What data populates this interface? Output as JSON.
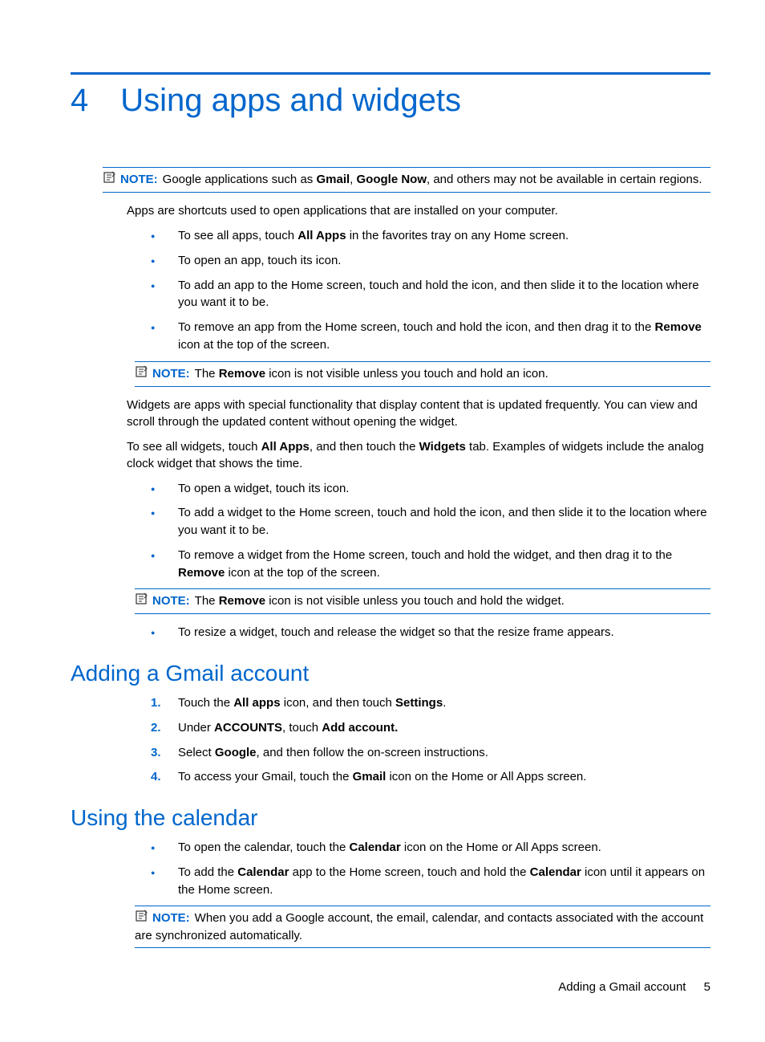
{
  "chapter": {
    "number": "4",
    "title": "Using apps and widgets"
  },
  "note_label": "NOTE:",
  "note1": {
    "pre": "Google applications such as ",
    "b1": "Gmail",
    "mid1": ", ",
    "b2": "Google Now",
    "post": ", and others may not be available in certain regions."
  },
  "p1": "Apps are shortcuts used to open applications that are installed on your computer.",
  "bullets1": {
    "i0": {
      "a": "To see all apps, touch ",
      "b": "All Apps",
      "c": " in the favorites tray on any Home screen."
    },
    "i1": {
      "a": "To open an app, touch its icon."
    },
    "i2": {
      "a": "To add an app to the Home screen, touch and hold the icon, and then slide it to the location where you want it to be."
    },
    "i3": {
      "a": "To remove an app from the Home screen, touch and hold the icon, and then drag it to the ",
      "b": "Remove",
      "c": " icon at the top of the screen."
    }
  },
  "note2": {
    "a": "The ",
    "b": "Remove",
    "c": " icon is not visible unless you touch and hold an icon."
  },
  "p2": "Widgets are apps with special functionality that display content that is updated frequently. You can view and scroll through the updated content without opening the widget.",
  "p3": {
    "a": "To see all widgets, touch ",
    "b1": "All Apps",
    "m": ", and then touch the ",
    "b2": "Widgets",
    "c": " tab. Examples of widgets include the analog clock widget that shows the time."
  },
  "bullets2": {
    "i0": {
      "a": "To open a widget, touch its icon."
    },
    "i1": {
      "a": "To add a widget to the Home screen, touch and hold the icon, and then slide it to the location where you want it to be."
    },
    "i2": {
      "a": "To remove a widget from the Home screen, touch and hold the widget, and then drag it to the ",
      "b": "Remove",
      "c": " icon at the top of the screen."
    }
  },
  "note3": {
    "a": "The ",
    "b": "Remove",
    "c": " icon is not visible unless you touch and hold the widget."
  },
  "bullets3": {
    "i0": {
      "a": "To resize a widget, touch and release the widget so that the resize frame appears."
    }
  },
  "section_gmail": "Adding a Gmail account",
  "steps1": {
    "s0": {
      "a": "Touch the ",
      "b1": "All apps",
      "m": " icon, and then touch ",
      "b2": "Settings",
      "c": "."
    },
    "s1": {
      "a": "Under ",
      "b1": "ACCOUNTS",
      "m": ", touch ",
      "b2": "Add account."
    },
    "s2": {
      "a": "Select ",
      "b1": "Google",
      "c": ", and then follow the on-screen instructions."
    },
    "s3": {
      "a": "To access your Gmail, touch the ",
      "b1": "Gmail",
      "c": " icon on the Home or All Apps screen."
    }
  },
  "section_cal": "Using the calendar",
  "bullets4": {
    "i0": {
      "a": "To open the calendar, touch the ",
      "b": "Calendar",
      "c": " icon on the Home or All Apps screen."
    },
    "i1": {
      "a": "To add the ",
      "b1": "Calendar",
      "m": " app to the Home screen, touch and hold the ",
      "b2": "Calendar",
      "c": " icon until it appears on the Home screen."
    }
  },
  "note4": {
    "a": "When you add a Google account, the email, calendar, and contacts associated with the account are synchronized automatically."
  },
  "footer": {
    "text": "Adding a Gmail account",
    "page": "5"
  }
}
